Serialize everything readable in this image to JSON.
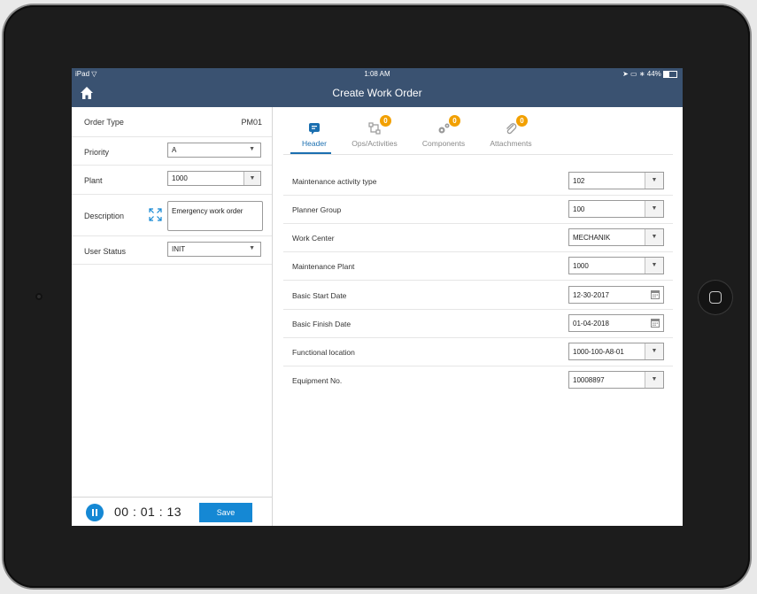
{
  "device": {
    "status_left": "iPad",
    "status_time": "1:08 AM",
    "status_battery": "44%"
  },
  "app": {
    "title": "Create Work Order"
  },
  "left_panel": {
    "order_type": {
      "label": "Order Type",
      "value": "PM01"
    },
    "priority": {
      "label": "Priority",
      "value": "A"
    },
    "plant": {
      "label": "Plant",
      "value": "1000"
    },
    "description": {
      "label": "Description",
      "value": "Emergency work order"
    },
    "user_status": {
      "label": "User Status",
      "value": "INIT"
    }
  },
  "footer": {
    "timer": "00 : 01 : 13",
    "save_label": "Save"
  },
  "tabs": [
    {
      "label": "Header",
      "icon": "header-icon",
      "active": true
    },
    {
      "label": "Ops/Activities",
      "icon": "operations-icon",
      "badge": "0"
    },
    {
      "label": "Components",
      "icon": "gears-icon",
      "badge": "0"
    },
    {
      "label": "Attachments",
      "icon": "paperclip-icon",
      "badge": "0"
    }
  ],
  "header_fields": [
    {
      "label": "Maintenance activity type",
      "value": "102",
      "control": "select"
    },
    {
      "label": "Planner Group",
      "value": "100",
      "control": "select"
    },
    {
      "label": "Work Center",
      "value": "MECHANIK",
      "control": "select"
    },
    {
      "label": "Maintenance Plant",
      "value": "1000",
      "control": "select"
    },
    {
      "label": "Basic Start Date",
      "value": "12-30-2017",
      "control": "date"
    },
    {
      "label": "Basic Finish Date",
      "value": "01-04-2018",
      "control": "date"
    },
    {
      "label": "Functional location",
      "value": "1000-100-A8-01",
      "control": "select"
    },
    {
      "label": "Equipment No.",
      "value": "10008897",
      "control": "select"
    }
  ],
  "colors": {
    "accent": "#1588d4",
    "navbar": "#3a5271",
    "badge": "#f2a000",
    "active_tab": "#1b6fb0"
  }
}
